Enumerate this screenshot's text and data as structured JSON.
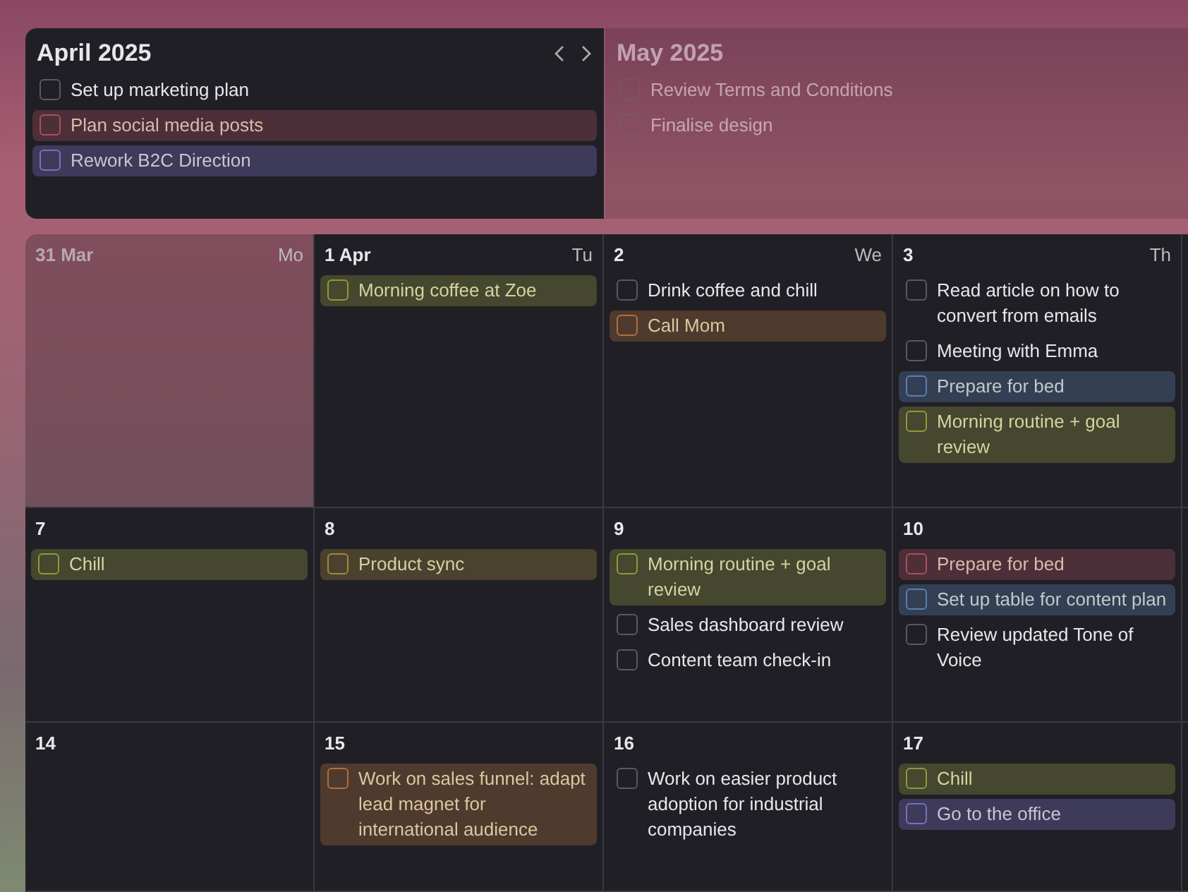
{
  "months": [
    {
      "title": "April 2025",
      "active": true,
      "tasks": [
        {
          "label": "Set up marketing plan",
          "checked": false
        },
        {
          "label": "Plan social media posts",
          "checked": false,
          "color": "#a8505c"
        },
        {
          "label": "Rework B2C Direction",
          "checked": false,
          "color": "#7a70c0"
        }
      ]
    },
    {
      "title": "May 2025",
      "active": false,
      "tasks": [
        {
          "label": "Review Terms and Conditions",
          "checked": false
        },
        {
          "label": "Finalise design",
          "checked": false
        }
      ]
    }
  ],
  "weeks": [
    {
      "days": [
        {
          "date": "31 Mar",
          "weekday": "Mo",
          "in_month": false
        },
        {
          "date": "1 Apr",
          "weekday": "Tu",
          "in_month": true,
          "tasks": [
            {
              "label": "Morning coffee at Zoe",
              "checked": false,
              "color": "#8f9a3a"
            }
          ]
        },
        {
          "date": "2",
          "weekday": "We",
          "in_month": true,
          "tasks": [
            {
              "label": "Drink coffee and chill",
              "checked": false
            },
            {
              "label": "Call Mom",
              "checked": false,
              "color": "#b0703a"
            }
          ]
        },
        {
          "date": "3",
          "weekday": "Th",
          "in_month": true,
          "tasks": [
            {
              "label": "Read article on how to convert from emails",
              "checked": false
            },
            {
              "label": "Meeting with Emma",
              "checked": false
            },
            {
              "label": "Prepare for bed",
              "checked": false,
              "color": "#5a80b0"
            },
            {
              "label": "Morning routine + goal review",
              "checked": false,
              "color": "#8f9a3a"
            }
          ]
        }
      ]
    },
    {
      "days": [
        {
          "date": "7",
          "in_month": true,
          "tasks": [
            {
              "label": "Chill",
              "checked": false,
              "color": "#8f9a3a"
            }
          ]
        },
        {
          "date": "8",
          "in_month": true,
          "tasks": [
            {
              "label": "Product sync",
              "checked": false,
              "color": "#a08a3a"
            }
          ]
        },
        {
          "date": "9",
          "in_month": true,
          "tasks": [
            {
              "label": "Morning routine + goal review",
              "checked": false,
              "color": "#8f9a3a"
            },
            {
              "label": "Sales dashboard review",
              "checked": false
            },
            {
              "label": "Content team check-in",
              "checked": false
            }
          ]
        },
        {
          "date": "10",
          "in_month": true,
          "tasks": [
            {
              "label": "Prepare for bed",
              "checked": false,
              "color": "#a8505c"
            },
            {
              "label": "Set up table for content plan",
              "checked": false,
              "color": "#5a80b0"
            },
            {
              "label": "Review updated Tone of Voice",
              "checked": false
            }
          ]
        }
      ]
    },
    {
      "days": [
        {
          "date": "14",
          "in_month": true
        },
        {
          "date": "15",
          "in_month": true,
          "tasks": [
            {
              "label": "Work on sales funnel: adapt lead magnet for international audience",
              "checked": false,
              "color": "#b0703a"
            }
          ]
        },
        {
          "date": "16",
          "in_month": true,
          "tasks": [
            {
              "label": "Work on easier product adoption for industrial companies",
              "checked": false
            }
          ]
        },
        {
          "date": "17",
          "in_month": true,
          "tasks": [
            {
              "label": "Chill",
              "checked": false,
              "color": "#8f9a3a"
            },
            {
              "label": "Go to the office",
              "checked": false,
              "color": "#7a70c0"
            }
          ]
        }
      ]
    }
  ]
}
